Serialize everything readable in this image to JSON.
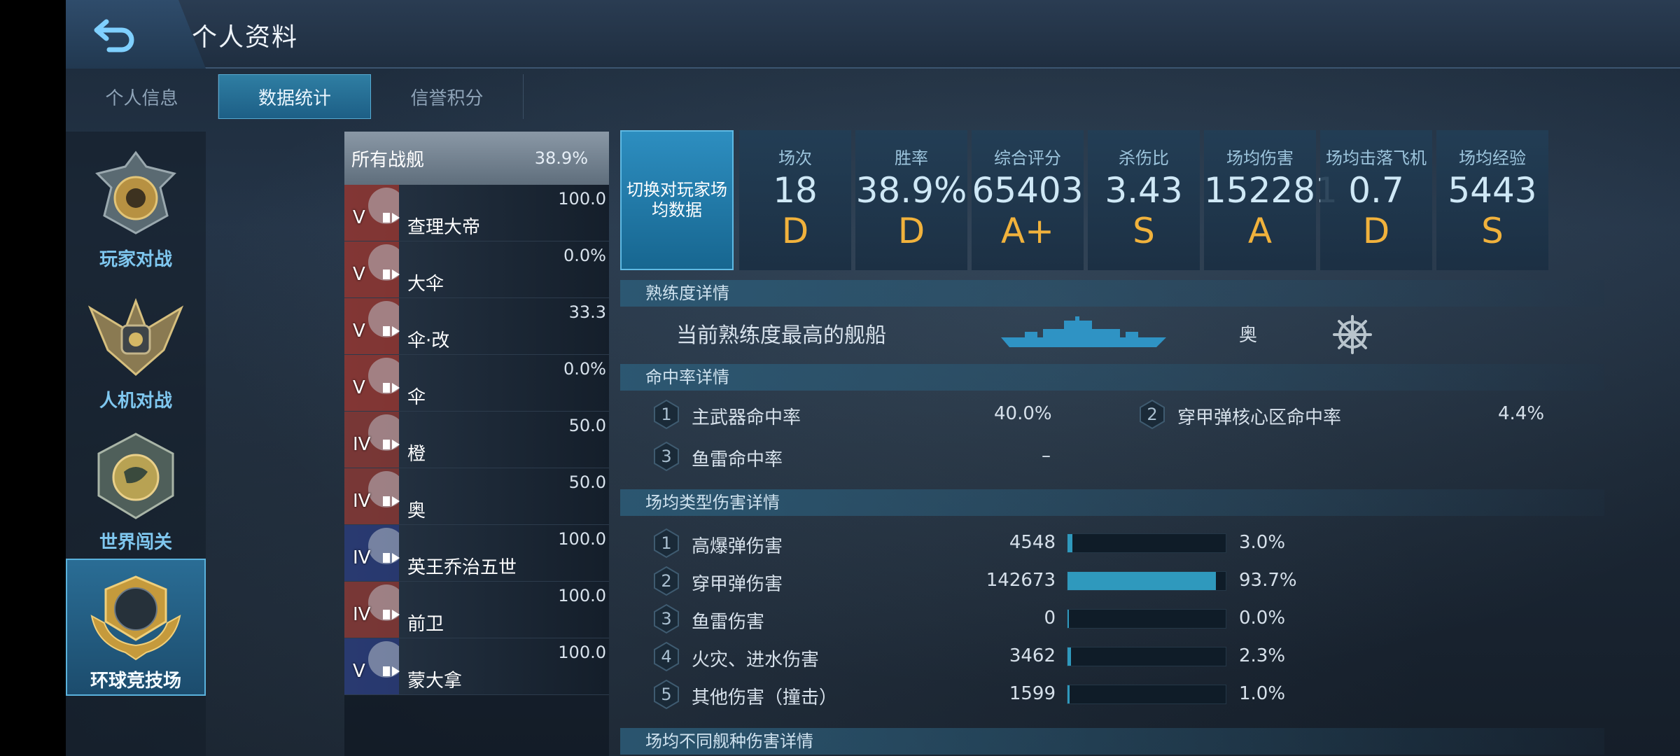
{
  "header": {
    "title": "个人资料"
  },
  "tabs": [
    {
      "label": "个人信息",
      "active": false
    },
    {
      "label": "数据统计",
      "active": true
    },
    {
      "label": "信誉积分",
      "active": false
    }
  ],
  "modes": [
    {
      "label": "玩家对战",
      "active": false
    },
    {
      "label": "人机对战",
      "active": false
    },
    {
      "label": "世界闯关",
      "active": false
    },
    {
      "label": "环球竞技场",
      "active": true
    }
  ],
  "ship_list": {
    "all": {
      "name": "所有战舰",
      "value": "38.9%"
    },
    "items": [
      {
        "tier": "V",
        "name": "查理大帝",
        "value": "100.0"
      },
      {
        "tier": "V",
        "name": "大伞",
        "value": "0.0%"
      },
      {
        "tier": "V",
        "name": "伞·改",
        "value": "33.3"
      },
      {
        "tier": "V",
        "name": "伞",
        "value": "0.0%"
      },
      {
        "tier": "IV",
        "name": "橙",
        "value": "50.0"
      },
      {
        "tier": "IV",
        "name": "奥",
        "value": "50.0"
      },
      {
        "tier": "IV",
        "name": "英王乔治五世",
        "value": "100.0"
      },
      {
        "tier": "IV",
        "name": "前卫",
        "value": "100.0"
      },
      {
        "tier": "V",
        "name": "蒙大拿",
        "value": "100.0"
      }
    ]
  },
  "switch_button": "切换对玩家场均数据",
  "stats": [
    {
      "label": "场次",
      "value": "18",
      "grade": "D"
    },
    {
      "label": "胜率",
      "value": "38.9%",
      "grade": "D"
    },
    {
      "label": "综合评分",
      "value": "65403",
      "grade": "A+"
    },
    {
      "label": "杀伤比",
      "value": "3.43",
      "grade": "S"
    },
    {
      "label": "场均伤害",
      "value": "152281",
      "grade": "A"
    },
    {
      "label": "场均击落飞机",
      "value": "0.7",
      "grade": "D"
    },
    {
      "label": "场均经验",
      "value": "5443",
      "grade": "S"
    }
  ],
  "proficiency": {
    "section": "熟练度详情",
    "label": "当前熟练度最高的舰船",
    "ship": "奥"
  },
  "hit_rate": {
    "section": "命中率详情",
    "items": [
      {
        "num": "1",
        "label": "主武器命中率",
        "value": "40.0%"
      },
      {
        "num": "2",
        "label": "穿甲弹核心区命中率",
        "value": "4.4%"
      },
      {
        "num": "3",
        "label": "鱼雷命中率",
        "value": "–"
      }
    ]
  },
  "damage_type": {
    "section": "场均类型伤害详情",
    "items": [
      {
        "num": "1",
        "label": "高爆弹伤害",
        "value": "4548",
        "percent": "3.0%",
        "fraction": 0.03
      },
      {
        "num": "2",
        "label": "穿甲弹伤害",
        "value": "142673",
        "percent": "93.7%",
        "fraction": 0.937
      },
      {
        "num": "3",
        "label": "鱼雷伤害",
        "value": "0",
        "percent": "0.0%",
        "fraction": 0.0
      },
      {
        "num": "4",
        "label": "火灾、进水伤害",
        "value": "3462",
        "percent": "2.3%",
        "fraction": 0.023
      },
      {
        "num": "5",
        "label": "其他伤害（撞击）",
        "value": "1599",
        "percent": "1.0%",
        "fraction": 0.01
      }
    ]
  },
  "ship_type_damage": {
    "section": "场均不同舰种伤害详情"
  },
  "colors": {
    "accent": "#2f99bd",
    "grade": "#f1b23c",
    "mode_label": "#7fc7ef"
  }
}
